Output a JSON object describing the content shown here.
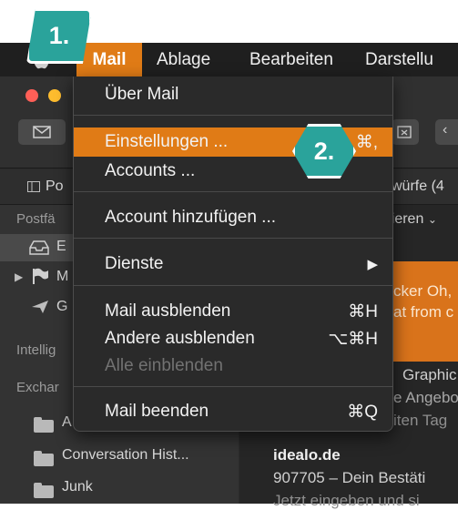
{
  "menubar": {
    "items": [
      "Mail",
      "Ablage",
      "Bearbeiten",
      "Darstellu"
    ]
  },
  "badges": {
    "step1": "1.",
    "step2": "2."
  },
  "mail_menu": {
    "items": [
      {
        "label": "Über Mail",
        "shortcut": ""
      },
      {
        "label": "Einstellungen ...",
        "shortcut": "⌘,"
      },
      {
        "label": "Accounts ...",
        "shortcut": ""
      },
      {
        "label": "Account hinzufügen ...",
        "shortcut": ""
      },
      {
        "label": "Dienste",
        "shortcut": "▶"
      },
      {
        "label": "Mail ausblenden",
        "shortcut": "⌘H"
      },
      {
        "label": "Andere ausblenden",
        "shortcut": "⌥⌘H"
      },
      {
        "label": "Alle einblenden",
        "shortcut": ""
      },
      {
        "label": "Mail beenden",
        "shortcut": "⌘Q"
      }
    ]
  },
  "favorites_bar": {
    "left": "Po",
    "right": "würfe (4"
  },
  "sidebar": {
    "postfach": "Postfä",
    "inbox_partial": "E",
    "flag_partial": "M",
    "sent_partial": "G",
    "intelligent": "Intellig",
    "exchange": "Exchar",
    "folder_a": "A",
    "folders": [
      "Conversation Hist...",
      "Junk"
    ]
  },
  "content": {
    "sort_label": "rtieren",
    "banner_line1": "cker Oh,",
    "banner_line2": "at from c",
    "item1_line1": "Graphic",
    "item1_line2": "e Angebo",
    "item1_line3": "iten Tag",
    "sender": "idealo.de",
    "subject": "907705 – Dein Bestäti",
    "preview": "Jetzt eingeben und si"
  },
  "colors": {
    "accent": "#e07b16",
    "badge": "#2aa39b"
  }
}
